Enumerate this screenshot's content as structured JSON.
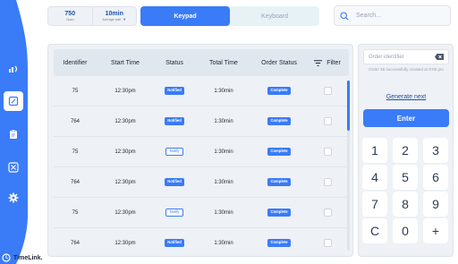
{
  "brand": {
    "name": "TimeLink.",
    "accent": "#3a7bf7"
  },
  "sidebar": {
    "items": [
      {
        "icon": "broadcast-icon",
        "name": "sidebar-item-broadcast"
      },
      {
        "icon": "edit-icon",
        "name": "sidebar-item-edit",
        "active": true
      },
      {
        "icon": "clipboard-icon",
        "name": "sidebar-item-clipboard"
      },
      {
        "icon": "dashboard-icon",
        "name": "sidebar-item-dashboard"
      },
      {
        "icon": "gear-icon",
        "name": "sidebar-item-settings"
      }
    ]
  },
  "stats": {
    "open_value": "750",
    "open_label": "Open",
    "wait_value": "10min",
    "wait_label": "Average wait"
  },
  "mode": {
    "keypad_label": "Keypad",
    "keyboard_label": "Keyboard",
    "active": "keypad"
  },
  "search": {
    "placeholder": "Search..."
  },
  "table": {
    "headers": {
      "identifier": "Identifier",
      "start_time": "Start Time",
      "status": "Status",
      "total_time": "Total Time",
      "order_status": "Order Status",
      "filter": "Filter"
    },
    "rows": [
      {
        "identifier": "75",
        "start_time": "12:30pm",
        "status": "Notified",
        "status_style": "filled",
        "total_time": "1:30min",
        "order_status": "Complete"
      },
      {
        "identifier": "764",
        "start_time": "12:30pm",
        "status": "Notified",
        "status_style": "filled",
        "total_time": "1:30min",
        "order_status": "Complete"
      },
      {
        "identifier": "75",
        "start_time": "12:30pm",
        "status": "Notify",
        "status_style": "outline",
        "total_time": "1:30min",
        "order_status": "Complete"
      },
      {
        "identifier": "764",
        "start_time": "12:30pm",
        "status": "Notified",
        "status_style": "filled",
        "total_time": "1:30min",
        "order_status": "Complete"
      },
      {
        "identifier": "75",
        "start_time": "12:30pm",
        "status": "Notify",
        "status_style": "outline",
        "total_time": "1:30min",
        "order_status": "Complete"
      },
      {
        "identifier": "764",
        "start_time": "12:30pm",
        "status": "Notified",
        "status_style": "filled",
        "total_time": "1:30min",
        "order_status": "Complete"
      }
    ]
  },
  "keypad": {
    "input_placeholder": "Order identifier",
    "note": "Order 45 successfully created at 9:06 pm",
    "generate_label": "Generate next",
    "enter_label": "Enter",
    "keys": [
      "1",
      "2",
      "3",
      "4",
      "5",
      "6",
      "7",
      "8",
      "9",
      "C",
      "0",
      "+"
    ]
  }
}
